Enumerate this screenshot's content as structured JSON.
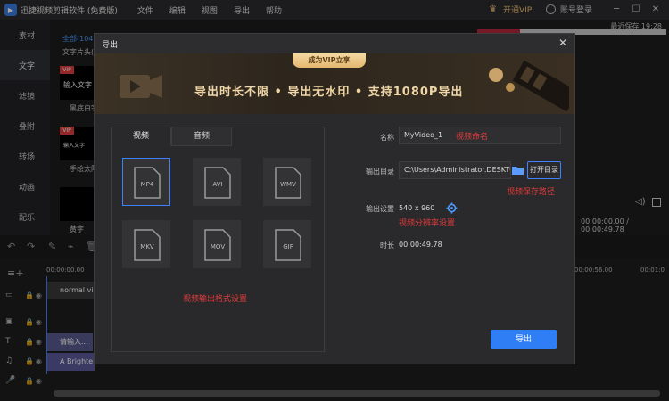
{
  "app": {
    "title": "迅捷视频剪辑软件 (免费版)",
    "menu": [
      "文件",
      "编辑",
      "视图",
      "导出",
      "帮助"
    ],
    "vip_label": "开通VIP",
    "account_label": "账号登录",
    "autosave": "最近保存 19:28",
    "window_buttons": [
      "minimize",
      "maximize",
      "close"
    ]
  },
  "sidebar": {
    "items": [
      {
        "label": "素材"
      },
      {
        "label": "文字",
        "active": true
      },
      {
        "label": "滤镜"
      },
      {
        "label": "叠附"
      },
      {
        "label": "转场"
      },
      {
        "label": "动画"
      },
      {
        "label": "配乐"
      }
    ]
  },
  "media": {
    "category_all": "全部(104)",
    "category_sub": "文字片头(6",
    "items": [
      {
        "badge": "VIP",
        "thumb_text": "输入文字",
        "label": "黑底白字"
      },
      {
        "badge": "VIP",
        "thumb_text": "输入文字",
        "label": "手绘太阳白"
      },
      {
        "badge": "",
        "thumb_text": "",
        "label": "黄字"
      }
    ]
  },
  "preview": {
    "time": "00:00:00.00 / 00:00:49.78",
    "zoom_level": 0.12
  },
  "timeline": {
    "ruler": [
      "00:00:00.00",
      "00:00:56.00",
      "00:01:0"
    ],
    "tracks": [
      {
        "icon": "video-track-icon",
        "clip": "normal vid"
      },
      {
        "icon": "pip-track-icon",
        "clip": ""
      },
      {
        "icon": "text-track-icon",
        "clip": "请输入..."
      },
      {
        "icon": "music-track-icon",
        "clip": "A Brighter"
      },
      {
        "icon": "mic-track-icon",
        "clip": ""
      }
    ]
  },
  "dialog": {
    "title": "导出",
    "banner": {
      "badge": "成为VIP立享",
      "text": "导出时长不限 • 导出无水印 • 支持1080P导出"
    },
    "tabs": [
      {
        "label": "视频",
        "active": true
      },
      {
        "label": "音频",
        "active": false
      }
    ],
    "formats": [
      "MP4",
      "AVI",
      "WMV",
      "MKV",
      "MOV",
      "GIF"
    ],
    "selected_format": "MP4",
    "format_annotation": "视频输出格式设置",
    "name_label": "名称",
    "name_value": "MyVideo_1",
    "name_annotation": "视频命名",
    "output_dir_label": "输出目录",
    "output_dir_value": "C:\\Users\\Administrator.DESKTOP-",
    "open_dir_button": "打开目录",
    "output_dir_annotation": "视频保存路径",
    "settings_label": "输出设置",
    "resolution": "540 x 960",
    "settings_annotation": "视频分辨率设置",
    "duration_label": "时长",
    "duration_value": "00:00:49.78",
    "export_button": "导出"
  },
  "colors": {
    "accent": "#2f7ef5",
    "annotation": "#e23b3b",
    "vip": "#f3c37a"
  }
}
